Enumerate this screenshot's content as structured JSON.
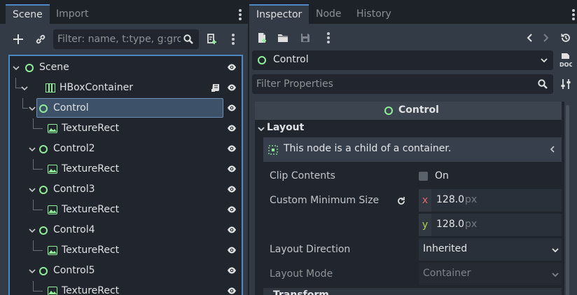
{
  "scene_dock": {
    "tabs": [
      {
        "label": "Scene",
        "active": true
      },
      {
        "label": "Import",
        "active": false
      }
    ],
    "filter_placeholder": "Filter: name, t:type, g:grou",
    "tree": [
      {
        "name": "Scene",
        "icon": "control-node-icon",
        "depth": 0,
        "expanded": true
      },
      {
        "name": "HBoxContainer",
        "icon": "hbox-container-icon",
        "depth": 1,
        "expanded": true,
        "has_script": true
      },
      {
        "name": "Control",
        "icon": "control-node-icon",
        "depth": 2,
        "expanded": true,
        "selected": true
      },
      {
        "name": "TextureRect",
        "icon": "texture-rect-icon",
        "depth": 3
      },
      {
        "name": "Control2",
        "icon": "control-node-icon",
        "depth": 2,
        "expanded": true
      },
      {
        "name": "TextureRect",
        "icon": "texture-rect-icon",
        "depth": 3
      },
      {
        "name": "Control3",
        "icon": "control-node-icon",
        "depth": 2,
        "expanded": true
      },
      {
        "name": "TextureRect",
        "icon": "texture-rect-icon",
        "depth": 3
      },
      {
        "name": "Control4",
        "icon": "control-node-icon",
        "depth": 2,
        "expanded": true
      },
      {
        "name": "TextureRect",
        "icon": "texture-rect-icon",
        "depth": 3
      },
      {
        "name": "Control5",
        "icon": "control-node-icon",
        "depth": 2,
        "expanded": true
      },
      {
        "name": "TextureRect",
        "icon": "texture-rect-icon",
        "depth": 3
      }
    ]
  },
  "inspector": {
    "tabs": [
      {
        "label": "Inspector",
        "active": true
      },
      {
        "label": "Node",
        "active": false
      },
      {
        "label": "History",
        "active": false
      }
    ],
    "selected_node": "Control",
    "filter_placeholder": "Filter Properties",
    "class_header": "Control",
    "category": "Layout",
    "info_message": "This node is a child of a container.",
    "properties": {
      "clip_contents": {
        "label": "Clip Contents",
        "value": "On",
        "checked": false
      },
      "custom_minimum_size": {
        "label": "Custom Minimum Size",
        "x_label": "x",
        "x": "128.0",
        "y_label": "y",
        "y": "128.0",
        "unit": "px"
      },
      "layout_direction": {
        "label": "Layout Direction",
        "value": "Inherited"
      },
      "layout_mode": {
        "label": "Layout Mode",
        "value": "Container"
      }
    },
    "next_category_partial": "Transform"
  },
  "colors": {
    "accent": "#4d88c4",
    "node_green": "#8eef97",
    "x_axis": "#e56666",
    "y_axis": "#a5d85a"
  }
}
